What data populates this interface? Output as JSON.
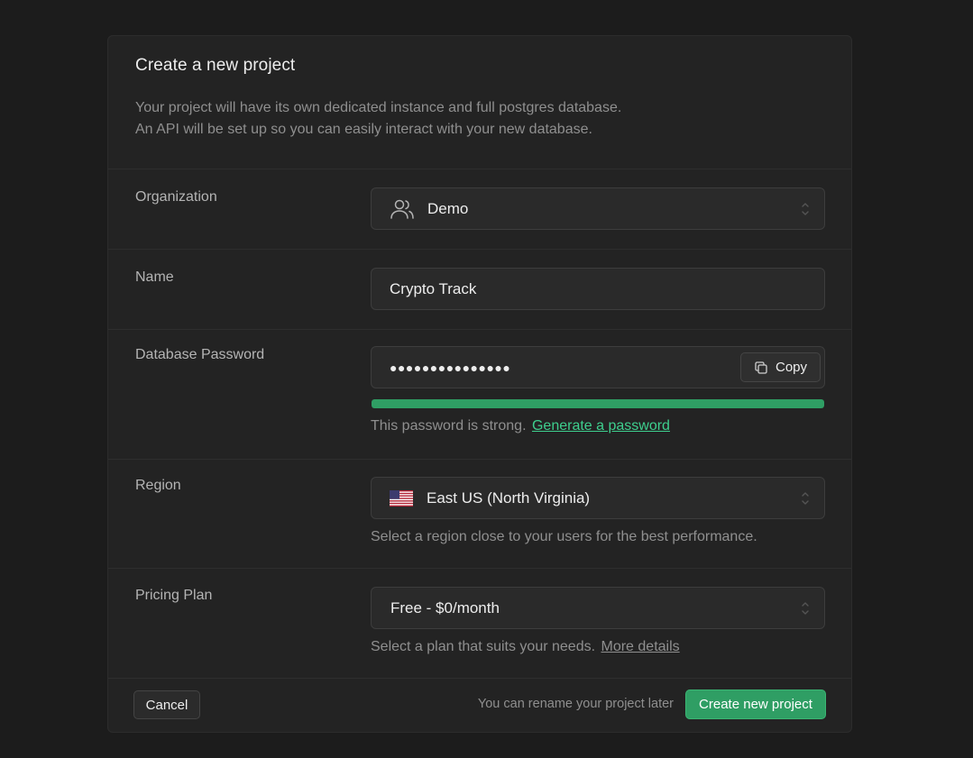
{
  "header": {
    "title": "Create a new project",
    "description_line1": "Your project will have its own dedicated instance and full postgres database.",
    "description_line2": "An API will be set up so you can easily interact with your new database."
  },
  "organization": {
    "label": "Organization",
    "value": "Demo",
    "icon": "users-icon"
  },
  "name": {
    "label": "Name",
    "value": "Crypto Track"
  },
  "password": {
    "label": "Database Password",
    "masked_value": "●●●●●●●●●●●●●●●",
    "copy_label": "Copy",
    "strength_fraction": 1.0,
    "strength_color": "#2f9e64",
    "helper_text": "This password is strong.",
    "generate_link": "Generate a password"
  },
  "region": {
    "label": "Region",
    "value": "East US (North Virginia)",
    "flag": "us-flag-icon",
    "helper_text": "Select a region close to your users for the best performance."
  },
  "plan": {
    "label": "Pricing Plan",
    "value": "Free - $0/month",
    "helper_text": "Select a plan that suits your needs.",
    "more_link": "More details"
  },
  "footer": {
    "cancel_label": "Cancel",
    "note": "You can rename your project later",
    "create_label": "Create new project"
  },
  "colors": {
    "accent": "#2f9e64",
    "link": "#3ecf8e"
  }
}
